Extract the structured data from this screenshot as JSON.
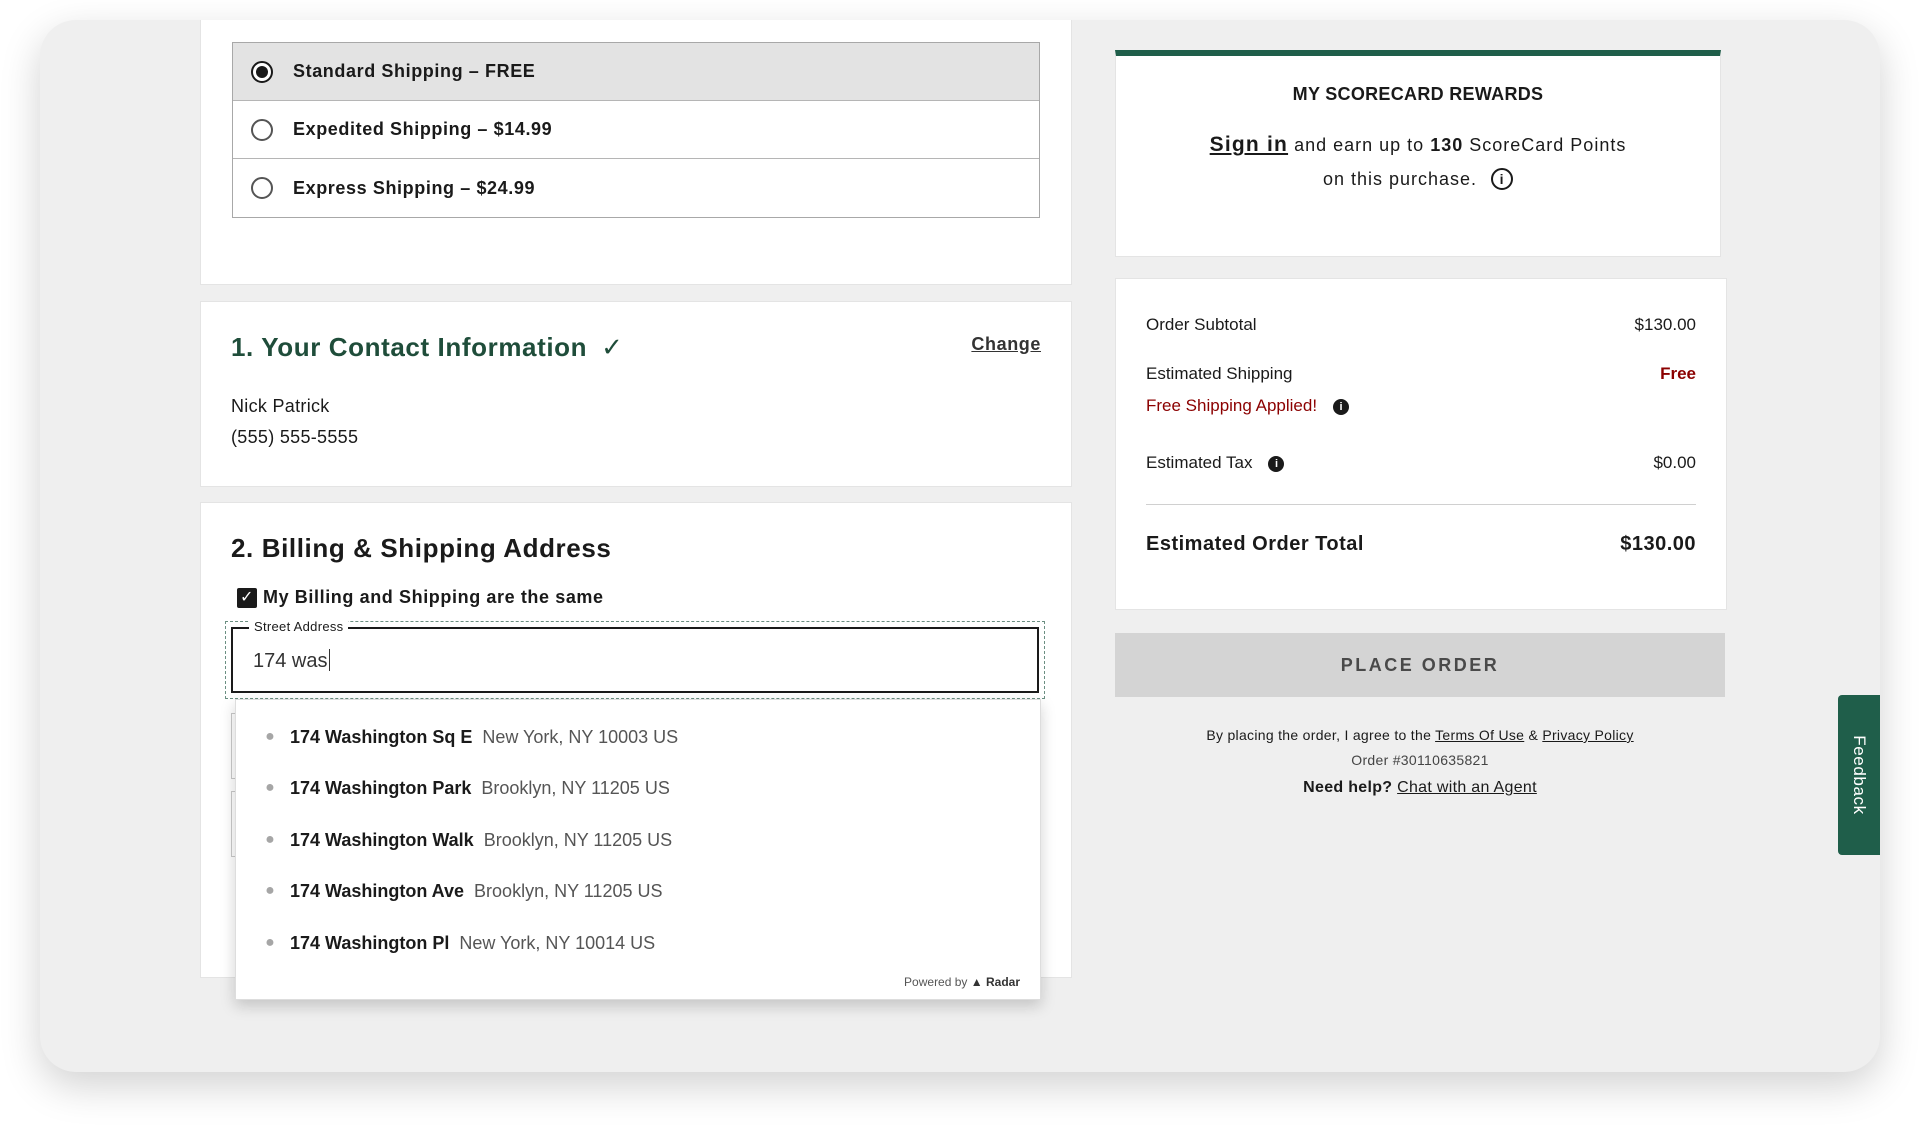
{
  "shipping": {
    "options": [
      {
        "label": "Standard Shipping – FREE",
        "selected": true
      },
      {
        "label": "Expedited Shipping – $14.99",
        "selected": false
      },
      {
        "label": "Express Shipping – $24.99",
        "selected": false
      }
    ]
  },
  "contact": {
    "title": "1. Your Contact Information",
    "change_label": "Change",
    "name": "Nick Patrick",
    "phone": "(555) 555-5555"
  },
  "billing": {
    "title": "2. Billing & Shipping Address",
    "same_label": "My Billing and Shipping are the same",
    "same_checked": true,
    "street_label": "Street Address",
    "street_value": "174 was"
  },
  "suggestions": {
    "items": [
      {
        "main": "174 Washington Sq E",
        "sub": "New York, NY 10003 US"
      },
      {
        "main": "174 Washington Park",
        "sub": "Brooklyn, NY 11205 US"
      },
      {
        "main": "174 Washington Walk",
        "sub": "Brooklyn, NY 11205 US"
      },
      {
        "main": "174 Washington Ave",
        "sub": "Brooklyn, NY 11205 US"
      },
      {
        "main": "174 Washington Pl",
        "sub": "New York, NY 10014 US"
      }
    ],
    "powered_by": "Powered by",
    "provider": "Radar"
  },
  "rewards": {
    "title": "MY SCORECARD REWARDS",
    "sign_in": "Sign in",
    "text_a": "and earn up to",
    "points": "130",
    "text_b": "ScoreCard Points",
    "text_c": "on this purchase."
  },
  "summary": {
    "subtotal_label": "Order Subtotal",
    "subtotal_value": "$130.00",
    "shipping_label": "Estimated Shipping",
    "shipping_value": "Free",
    "free_applied": "Free Shipping Applied!",
    "tax_label": "Estimated Tax",
    "tax_value": "$0.00",
    "total_label": "Estimated Order Total",
    "total_value": "$130.00"
  },
  "place_order_label": "PLACE ORDER",
  "legal": {
    "agree": "By placing the order, I agree to the",
    "terms": "Terms Of Use",
    "amp": "&",
    "privacy": "Privacy Policy",
    "order_number": "Order #30110635821",
    "help": "Need help?",
    "chat": "Chat with an Agent"
  },
  "feedback_label": "Feedback",
  "colors": {
    "brand_green": "#1f5e4a",
    "heading_green": "#1f4d3a",
    "alert_red": "#8b0000",
    "background": "#efefef"
  }
}
